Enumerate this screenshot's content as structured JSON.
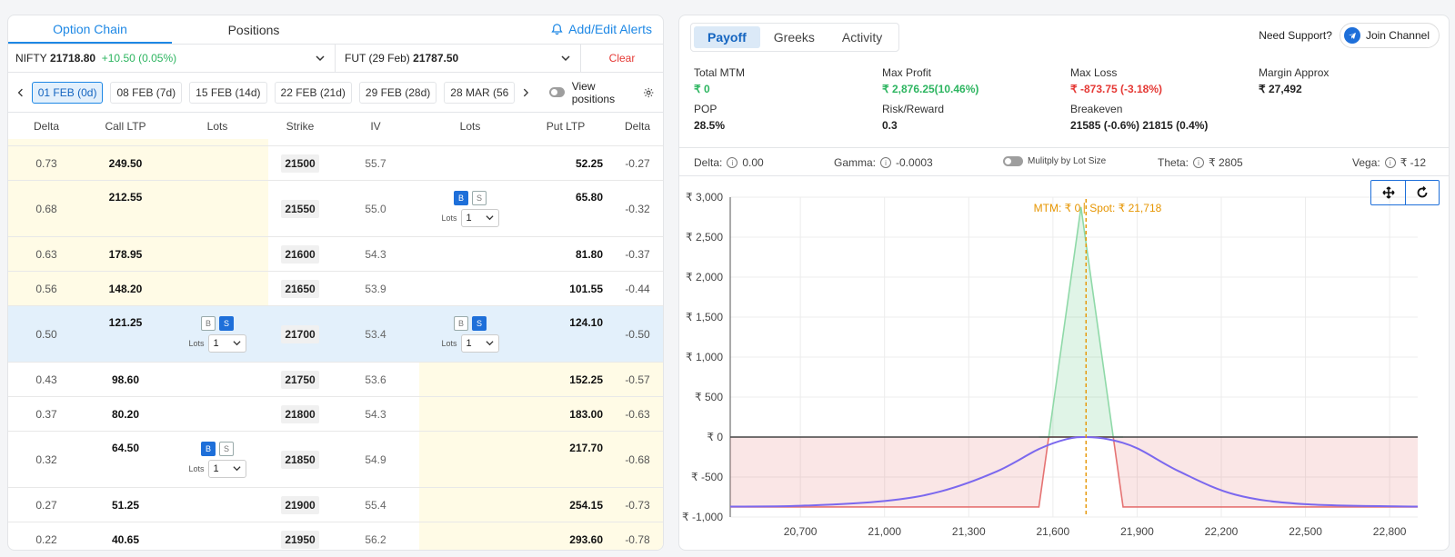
{
  "left": {
    "tabs": [
      "Option Chain",
      "Positions"
    ],
    "alerts_label": "Add/Edit Alerts",
    "quote": {
      "symbol": "NIFTY",
      "price": "21718.80",
      "change": "+10.50 (0.05%)",
      "fut_label": "FUT (29 Feb)",
      "fut_price": "21787.50",
      "clear": "Clear"
    },
    "expiries": [
      "01 FEB (0d)",
      "08 FEB (7d)",
      "15 FEB (14d)",
      "22 FEB (21d)",
      "29 FEB (28d)",
      "28 MAR (56"
    ],
    "view_positions": "View positions",
    "headers": [
      "Delta",
      "Call LTP",
      "Lots",
      "Strike",
      "IV",
      "Lots",
      "Put LTP",
      "Delta"
    ],
    "lots_label": "Lots",
    "lot_value": "1",
    "b": "B",
    "s": "S",
    "rows": [
      {
        "cd": "0.73",
        "cl": "249.50",
        "strike": "21500",
        "iv": "55.7",
        "pl": "52.25",
        "pd": "-0.27",
        "callItm": true,
        "putItm": false
      },
      {
        "cd": "0.68",
        "cl": "212.55",
        "strike": "21550",
        "iv": "55.0",
        "pl": "65.80",
        "pd": "-0.32",
        "callItm": true,
        "putItm": false,
        "putPos": "B"
      },
      {
        "cd": "0.63",
        "cl": "178.95",
        "strike": "21600",
        "iv": "54.3",
        "pl": "81.80",
        "pd": "-0.37",
        "callItm": true,
        "putItm": false
      },
      {
        "cd": "0.56",
        "cl": "148.20",
        "strike": "21650",
        "iv": "53.9",
        "pl": "101.55",
        "pd": "-0.44",
        "callItm": true,
        "putItm": false
      },
      {
        "cd": "0.50",
        "cl": "121.25",
        "strike": "21700",
        "iv": "53.4",
        "pl": "124.10",
        "pd": "-0.50",
        "atm": true,
        "callPos": "S",
        "putPos": "S"
      },
      {
        "cd": "0.43",
        "cl": "98.60",
        "strike": "21750",
        "iv": "53.6",
        "pl": "152.25",
        "pd": "-0.57",
        "callItm": false,
        "putItm": true
      },
      {
        "cd": "0.37",
        "cl": "80.20",
        "strike": "21800",
        "iv": "54.3",
        "pl": "183.00",
        "pd": "-0.63",
        "callItm": false,
        "putItm": true
      },
      {
        "cd": "0.32",
        "cl": "64.50",
        "strike": "21850",
        "iv": "54.9",
        "pl": "217.70",
        "pd": "-0.68",
        "callItm": false,
        "putItm": true,
        "callPos": "B"
      },
      {
        "cd": "0.27",
        "cl": "51.25",
        "strike": "21900",
        "iv": "55.4",
        "pl": "254.15",
        "pd": "-0.73",
        "callItm": false,
        "putItm": true
      },
      {
        "cd": "0.22",
        "cl": "40.65",
        "strike": "21950",
        "iv": "56.2",
        "pl": "293.60",
        "pd": "-0.78",
        "callItm": false,
        "putItm": true
      }
    ]
  },
  "right": {
    "tabs": [
      "Payoff",
      "Greeks",
      "Activity"
    ],
    "support": "Need Support?",
    "join": "Join Channel",
    "stats": [
      {
        "label": "Total MTM",
        "value": "₹ 0",
        "color": "green"
      },
      {
        "label": "Max Profit",
        "value": "₹ 2,876.25(10.46%)",
        "color": "green"
      },
      {
        "label": "Max Loss",
        "value": "₹ -873.75 (-3.18%)",
        "color": "red"
      },
      {
        "label": "Margin Approx",
        "value": "₹ 27,492",
        "color": ""
      },
      {
        "label": "POP",
        "value": "28.5%",
        "color": ""
      },
      {
        "label": "Risk/Reward",
        "value": "0.3",
        "color": ""
      },
      {
        "label": "Breakeven",
        "value": "21585 (-0.6%)   21815 (0.4%)",
        "color": ""
      }
    ],
    "greeks": {
      "delta_label": "Delta:",
      "delta": "0.00",
      "gamma_label": "Gamma:",
      "gamma": "-0.0003",
      "multiply": "Mulitply by Lot Size",
      "theta_label": "Theta:",
      "theta": "₹ 2805",
      "vega_label": "Vega:",
      "vega": "₹ -12"
    }
  },
  "chart_data": {
    "type": "line",
    "mtm_label": "MTM: ₹ 0",
    "spot_label": "Spot: ₹ 21,718",
    "spot": 21718,
    "xlim": [
      20450,
      22900
    ],
    "ylim": [
      -1000,
      3000
    ],
    "xticks": [
      20700,
      21000,
      21300,
      21600,
      21900,
      22200,
      22500,
      22800
    ],
    "xtick_labels": [
      "20,700",
      "21,000",
      "21,300",
      "21,600",
      "21,900",
      "22,200",
      "22,500",
      "22,800"
    ],
    "yticks": [
      3000,
      2500,
      2000,
      1500,
      1000,
      500,
      0,
      -500,
      -1000
    ],
    "ytick_labels": [
      "₹ 3,000",
      "₹ 2,500",
      "₹ 2,000",
      "₹ 1,500",
      "₹ 1,000",
      "₹ 500",
      "₹ 0",
      "₹ -500",
      "₹ -1,000"
    ],
    "payoff_x": [
      20450,
      21550,
      21585,
      21700,
      21815,
      21850,
      22900
    ],
    "payoff_y": [
      -873.75,
      -873.75,
      0,
      2876.25,
      0,
      -873.75,
      -873.75
    ],
    "mtm_x": [
      20450,
      20700,
      21000,
      21200,
      21400,
      21550,
      21650,
      21718,
      21800,
      21900,
      22050,
      22250,
      22500,
      22900
    ],
    "mtm_y": [
      -870,
      -860,
      -800,
      -680,
      -430,
      -150,
      -25,
      0,
      -30,
      -140,
      -430,
      -720,
      -840,
      -870
    ],
    "colors": {
      "profit": "#2db560",
      "loss": "#e57373",
      "mtm": "#7b68ee",
      "spot": "#e69500"
    }
  }
}
